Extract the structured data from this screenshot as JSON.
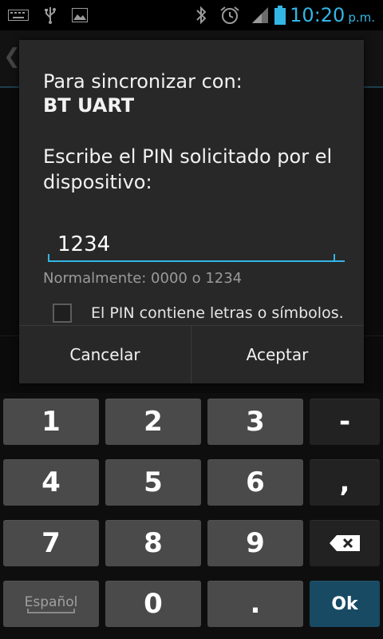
{
  "status_bar": {
    "icons": [
      "keyboard-icon",
      "usb-icon",
      "image-icon",
      "bluetooth-icon",
      "alarm-icon",
      "signal-icon",
      "battery-icon"
    ],
    "time": "10:20",
    "ampm": "p.m."
  },
  "dialog": {
    "title_line": "Para sincronizar con:",
    "device_name": "BT UART",
    "instruction_line1": "Escribe el PIN solicitado por el",
    "instruction_line2": "dispositivo:",
    "pin_value": "1234",
    "hint": "Normalmente: 0000 o 1234",
    "checkbox_label": "El PIN contiene letras o símbolos.",
    "checkbox_checked": false,
    "cancel_label": "Cancelar",
    "accept_label": "Aceptar"
  },
  "keyboard": {
    "keys": {
      "k1": "1",
      "k2": "2",
      "k3": "3",
      "minus": "-",
      "k4": "4",
      "k5": "5",
      "k6": "6",
      "comma": ",",
      "k7": "7",
      "k8": "8",
      "k9": "9",
      "lang": "Español",
      "k0": "0",
      "period": ".",
      "ok": "Ok"
    },
    "backspace_icon": "backspace-icon"
  },
  "colors": {
    "accent": "#33b5e5",
    "dialog_bg": "#282828",
    "key_bg": "#4a4a4a",
    "key_dark_bg": "#222222",
    "ok_bg": "#184a63"
  }
}
